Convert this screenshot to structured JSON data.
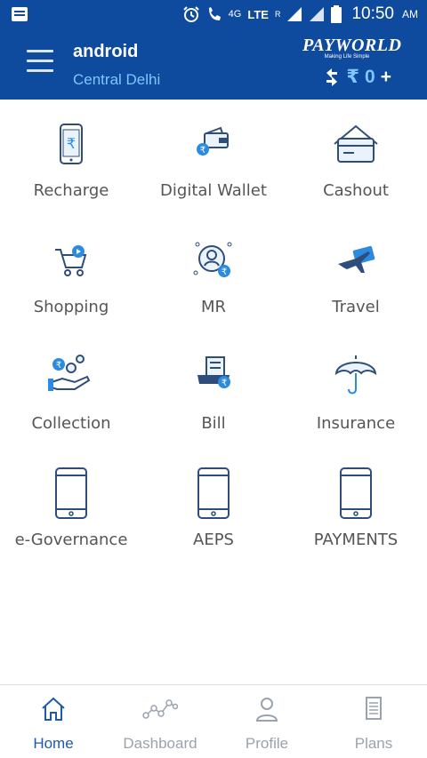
{
  "status_bar": {
    "network": "4G",
    "lte": "LTE",
    "roaming": "R",
    "time": "10:50",
    "ampm": "AM"
  },
  "header": {
    "user_name": "android",
    "location": "Central Delhi",
    "brand_name": "PAYWORLD",
    "brand_tagline": "Making Life Simple",
    "currency_symbol": "₹",
    "balance": "0",
    "add_label": "+"
  },
  "grid": {
    "items": [
      {
        "label": "Recharge",
        "icon": "phone-rupee-icon"
      },
      {
        "label": "Digital Wallet",
        "icon": "wallet-icon"
      },
      {
        "label": "Cashout",
        "icon": "card-hand-icon"
      },
      {
        "label": "Shopping",
        "icon": "cart-icon"
      },
      {
        "label": "MR",
        "icon": "money-remit-icon"
      },
      {
        "label": "Travel",
        "icon": "plane-ticket-icon"
      },
      {
        "label": "Collection",
        "icon": "coins-hand-icon"
      },
      {
        "label": "Bill",
        "icon": "bill-icon"
      },
      {
        "label": "Insurance",
        "icon": "umbrella-icon"
      },
      {
        "label": "e-Governance",
        "icon": "mobile-icon"
      },
      {
        "label": "AEPS",
        "icon": "mobile-icon"
      },
      {
        "label": "PAYMENTS",
        "icon": "mobile-icon"
      }
    ]
  },
  "bottom_nav": {
    "items": [
      {
        "label": "Home",
        "icon": "home-icon",
        "active": true
      },
      {
        "label": "Dashboard",
        "icon": "dashboard-icon",
        "active": false
      },
      {
        "label": "Profile",
        "icon": "profile-icon",
        "active": false
      },
      {
        "label": "Plans",
        "icon": "plans-icon",
        "active": false
      }
    ]
  },
  "colors": {
    "primary": "#0e4a9e",
    "accent": "#7fc6ff",
    "icon_blue": "#2a8be0",
    "icon_stroke": "#2f4d7a"
  }
}
